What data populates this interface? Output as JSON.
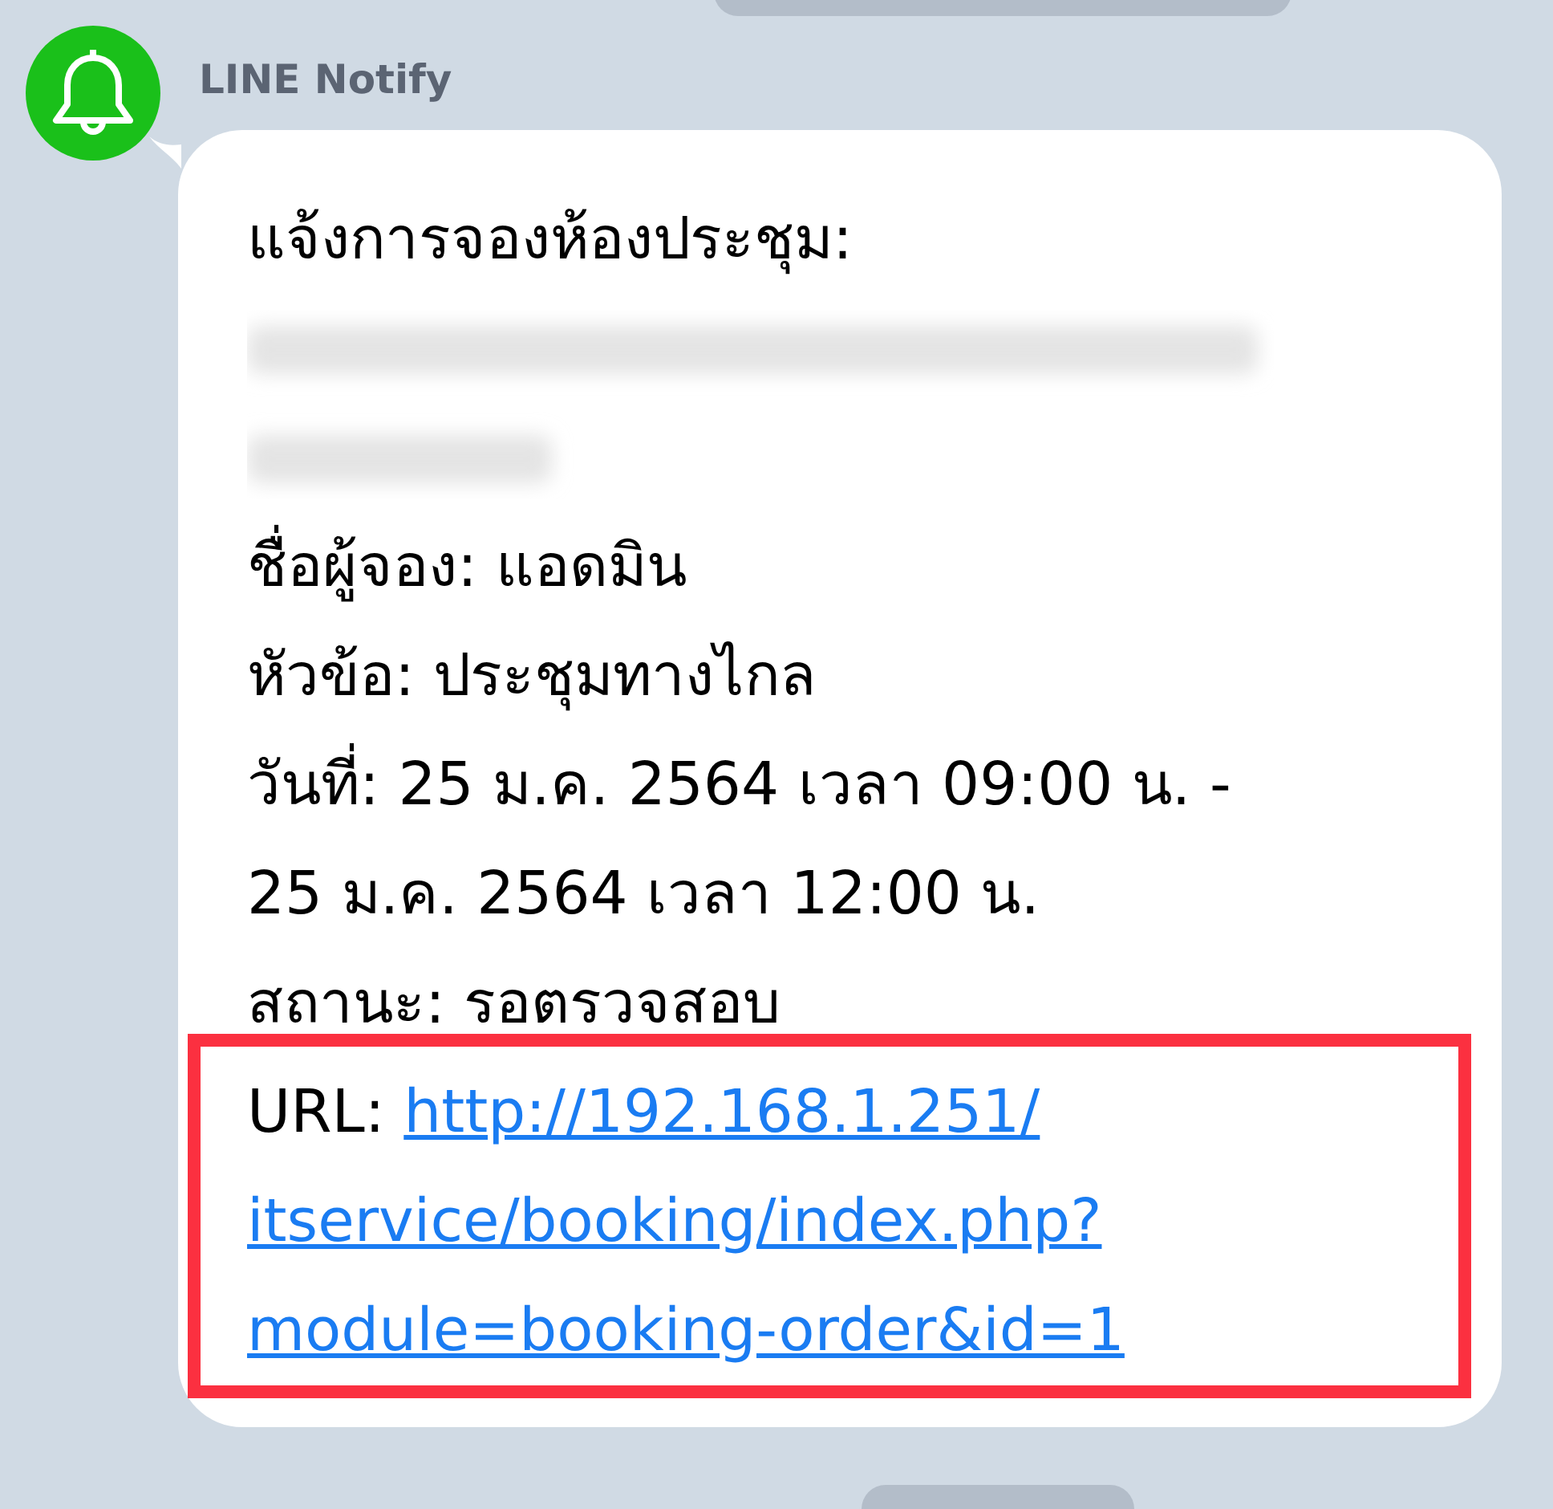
{
  "sender": {
    "name": "LINE Notify"
  },
  "message": {
    "heading": "แจ้งการจองห้องประชุม:",
    "lines": [
      "ชื่อผู้จอง: แอดมิน",
      "หัวข้อ: ประชุมทางไกล",
      "วันที่: 25 ม.ค. 2564 เวลา 09:00 น. -",
      "25 ม.ค. 2564 เวลา 12:00 น.",
      "สถานะ: รอตรวจสอบ"
    ],
    "url_label": "URL:",
    "url_lines": [
      "http://192.168.1.251/",
      "itservice/booking/index.php?",
      "module=booking-order&id=1"
    ]
  }
}
